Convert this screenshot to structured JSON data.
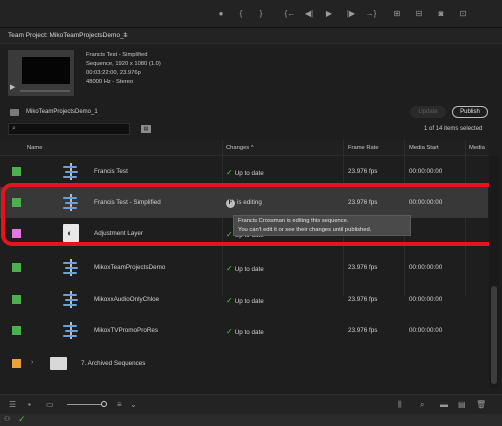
{
  "panel": {
    "title": "Team Project: MikoTeamProjectsDemo_1",
    "menu_icon": "hamburger-icon"
  },
  "preview": {
    "name": "Francis Test - Simplified",
    "details": [
      "Sequence, 1920 x 1080 (1.0)",
      "00:03:22:00, 23.976p",
      "48000 Hz - Stereo"
    ]
  },
  "toolbar": {
    "folder": "MikoTeamProjectsDemo_1",
    "update_label": "Update",
    "publish_label": "Publish"
  },
  "search": {
    "placeholder": "",
    "count": "1 of 14 items selected"
  },
  "columns": {
    "name": "Name",
    "changes": "Changes ^",
    "frame_rate": "Frame Rate",
    "media_start": "Media Start",
    "media_end": "Media"
  },
  "rows": [
    {
      "name": "Francis Test",
      "change": "Up to date",
      "fps": "23.976 fps",
      "start": "00:00:00:00",
      "color": "#4caf50",
      "icon": "sequence-icon"
    },
    {
      "name": "Francis Test - Simplified",
      "change": "is editing",
      "avatar": "F",
      "fps": "23.976 fps",
      "start": "00:00:00:00",
      "color": "#4caf50",
      "icon": "sequence-icon"
    },
    {
      "name": "Adjustment Layer",
      "change": "Up to date",
      "fps": "",
      "start": "",
      "color": "#e07ae0",
      "icon": "adjustment-layer-icon"
    },
    {
      "name": "MikoxTeamProjectsDemo",
      "change": "Up to date",
      "fps": "23.976 fps",
      "start": "00:00:00:00",
      "color": "#4caf50",
      "icon": "sequence-icon"
    },
    {
      "name": "MikoxxAudioOnlyChloe",
      "change": "Up to date",
      "fps": "23.976 fps",
      "start": "00:00:00:00",
      "color": "#4caf50",
      "icon": "sequence-icon"
    },
    {
      "name": "MikoxTVPromoProRes",
      "change": "Up to date",
      "fps": "23.976 fps",
      "start": "00:00:00:00",
      "color": "#4caf50",
      "icon": "sequence-icon"
    },
    {
      "name": "7. Archived Sequences",
      "change": "",
      "fps": "",
      "start": "",
      "color": "#e8a33a",
      "icon": "bin-icon"
    }
  ],
  "tooltip": {
    "line1": "Francis Crossman is editing this sequence.",
    "line2": "You can't edit it or see their changes until published."
  },
  "colors": {
    "highlight": "#e8121c",
    "check": "#5fb341",
    "selected_row": "#383838"
  }
}
